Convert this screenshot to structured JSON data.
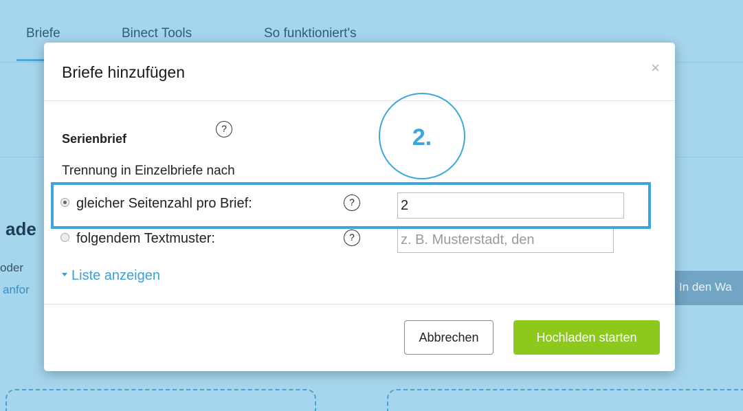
{
  "nav": {
    "tabs": [
      {
        "label": "Briefe"
      },
      {
        "label": "Binect Tools"
      },
      {
        "label": "So funktioniert's"
      }
    ]
  },
  "background": {
    "heading_fragment": "ade",
    "text_fragment": "oder",
    "link_fragment": "anfor",
    "button_fragment": "In den Wa"
  },
  "modal": {
    "title": "Briefe hinzufügen",
    "close_symbol": "×",
    "section_title": "Serienbrief",
    "help_symbol": "?",
    "split_label": "Trennung in Einzelbriefe nach",
    "options": [
      {
        "label": "gleicher Seitenzahl pro Brief:",
        "value": "2",
        "checked": true
      },
      {
        "label": "folgendem Textmuster:",
        "placeholder": "z. B. Musterstadt, den",
        "checked": false
      }
    ],
    "list_link": "Liste anzeigen",
    "cancel_label": "Abbrechen",
    "submit_label": "Hochladen starten"
  },
  "annotation": {
    "step_label": "2."
  },
  "colors": {
    "accent": "#3aa6dc",
    "submit": "#8dc81d",
    "page_background": "#a6d6ee"
  }
}
